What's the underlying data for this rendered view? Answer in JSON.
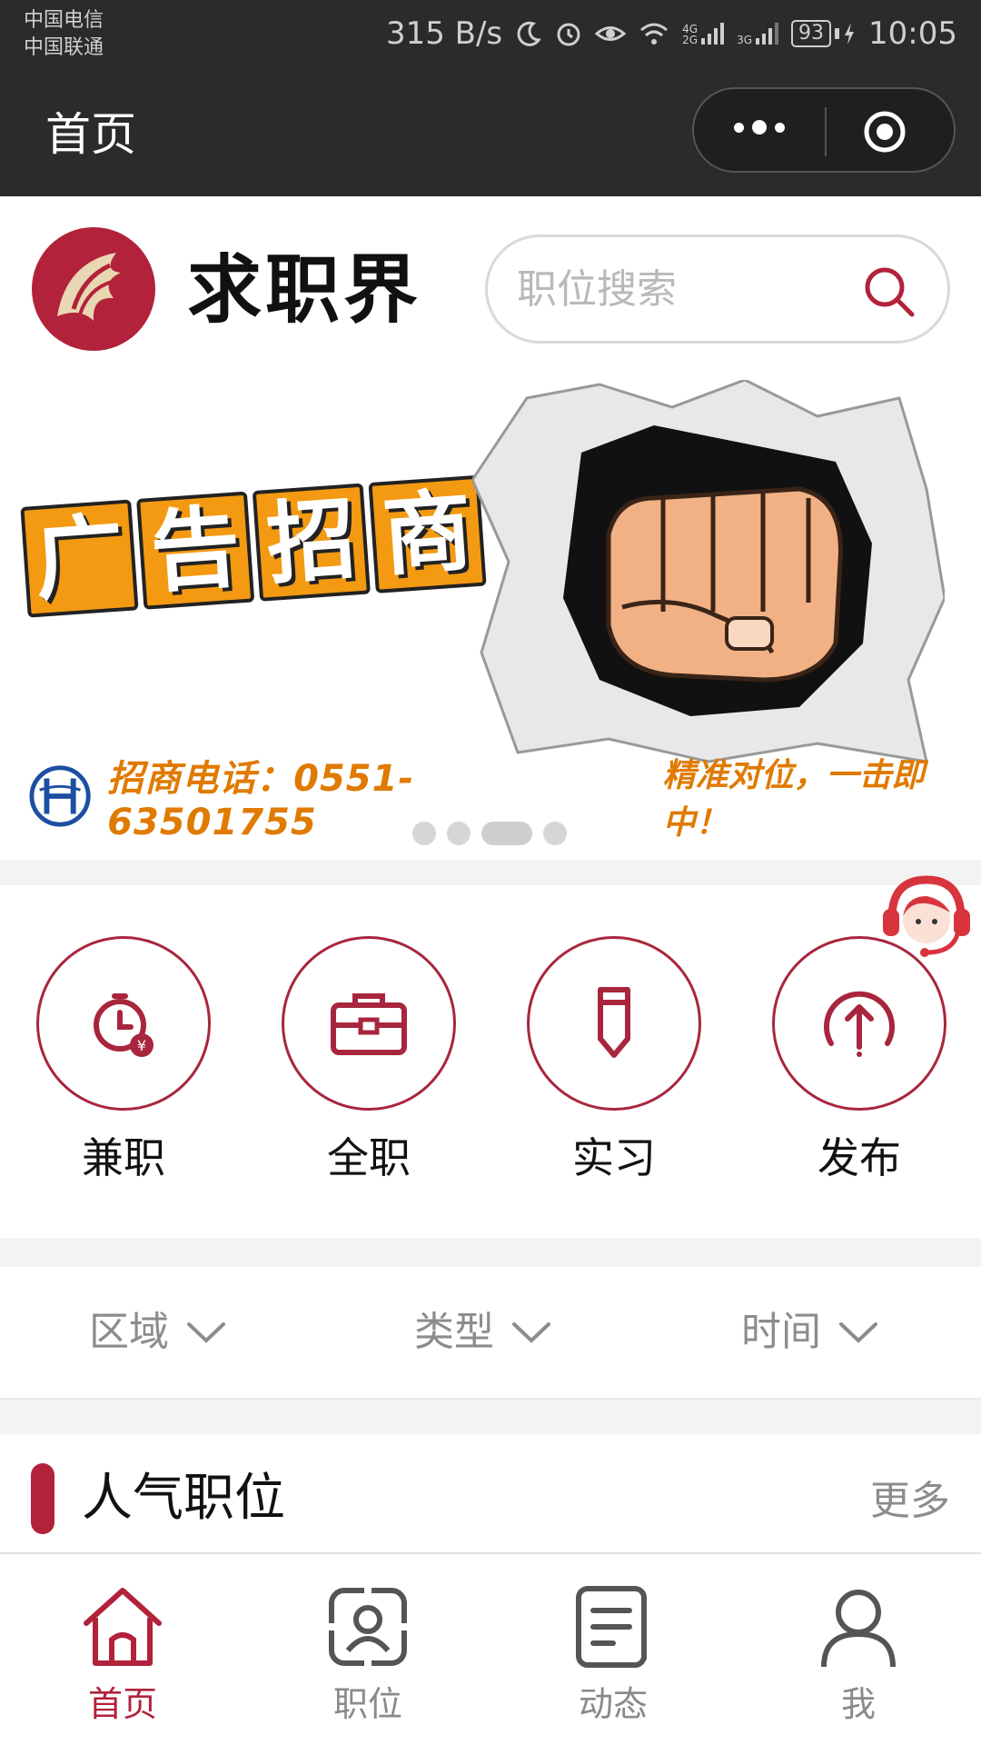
{
  "status_bar": {
    "carrier1": "中国电信",
    "carrier2": "中国联通",
    "speed": "315 B/s",
    "net1": "4G",
    "net2": "2G",
    "net3": "3G",
    "battery": "93",
    "time": "10:05"
  },
  "nav": {
    "title": "首页",
    "more_icon": "more-dots-icon",
    "close_icon": "target-icon"
  },
  "header": {
    "brand": "求职界",
    "search_placeholder": "职位搜索"
  },
  "banner": {
    "title_chars": [
      "广",
      "告",
      "招",
      "商"
    ],
    "phone": "招商电话：0551-63501755",
    "slogan": "精准对位，一击即中！",
    "slide_count": 4,
    "active_slide": 3
  },
  "categories": [
    {
      "label": "兼职",
      "icon": "part-time-clock-icon"
    },
    {
      "label": "全职",
      "icon": "briefcase-icon"
    },
    {
      "label": "实习",
      "icon": "pencil-icon"
    },
    {
      "label": "发布",
      "icon": "upload-arrow-icon"
    }
  ],
  "filters": [
    {
      "label": "区域"
    },
    {
      "label": "类型"
    },
    {
      "label": "时间"
    }
  ],
  "popular": {
    "title": "人气职位",
    "more": "更多"
  },
  "tabs": [
    {
      "label": "首页",
      "icon": "home-icon",
      "active": true
    },
    {
      "label": "职位",
      "icon": "position-icon",
      "active": false
    },
    {
      "label": "动态",
      "icon": "news-icon",
      "active": false
    },
    {
      "label": "我",
      "icon": "user-icon",
      "active": false
    }
  ],
  "colors": {
    "accent": "#b2223b",
    "nav_bg": "#2b2b2b",
    "banner_orange": "#f39a12"
  }
}
